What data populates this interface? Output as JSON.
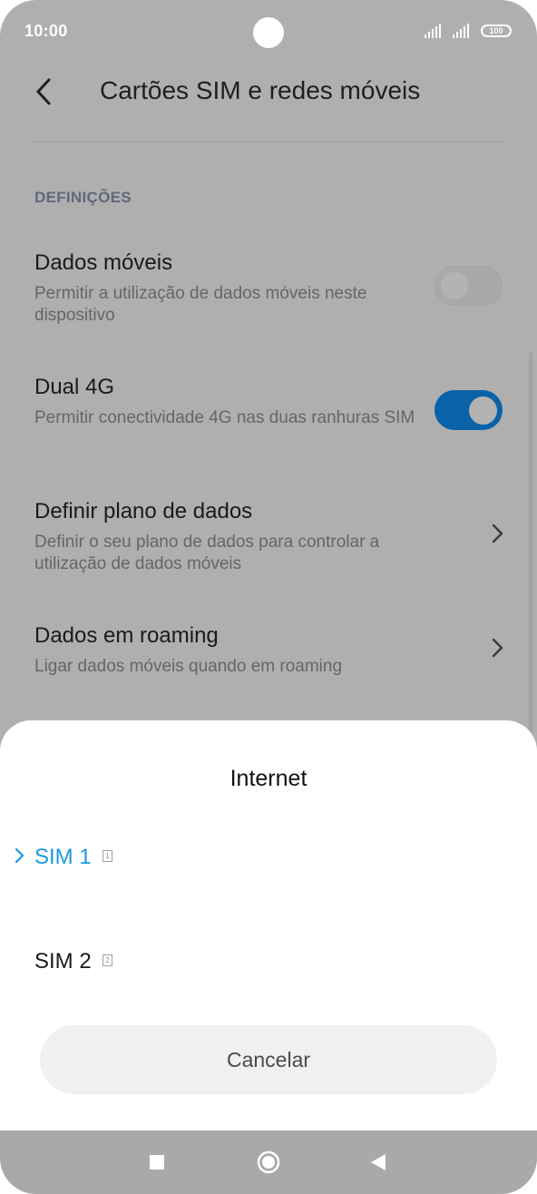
{
  "status_bar": {
    "time": "10:00",
    "battery": "100"
  },
  "header": {
    "title": "Cartões SIM e redes móveis"
  },
  "section": {
    "label": "DEFINIÇÕES"
  },
  "settings": [
    {
      "title": "Dados móveis",
      "subtitle": "Permitir a utilização de dados móveis neste dispositivo",
      "control": "toggle",
      "state": "off"
    },
    {
      "title": "Dual 4G",
      "subtitle": "Permitir conectividade 4G nas duas ranhuras SIM",
      "control": "toggle",
      "state": "on"
    },
    {
      "title": "Definir plano de dados",
      "subtitle": "Definir o seu plano de dados para controlar a utilização de dados móveis",
      "control": "chevron"
    },
    {
      "title": "Dados em roaming",
      "subtitle": "Ligar dados móveis quando em roaming",
      "control": "chevron"
    }
  ],
  "sheet": {
    "title": "Internet",
    "options": [
      {
        "label": "SIM 1",
        "badge": "1",
        "selected": true
      },
      {
        "label": "SIM 2",
        "badge": "2",
        "selected": false
      }
    ],
    "cancel_label": "Cancelar"
  },
  "colors": {
    "accent": "#0a62a8",
    "selected_text": "#1a9ae0",
    "overlay_bg": "#afafaf"
  },
  "icons": [
    "back-arrow-icon",
    "chevron-right-icon",
    "square-icon",
    "circle-icon",
    "triangle-back-icon"
  ]
}
